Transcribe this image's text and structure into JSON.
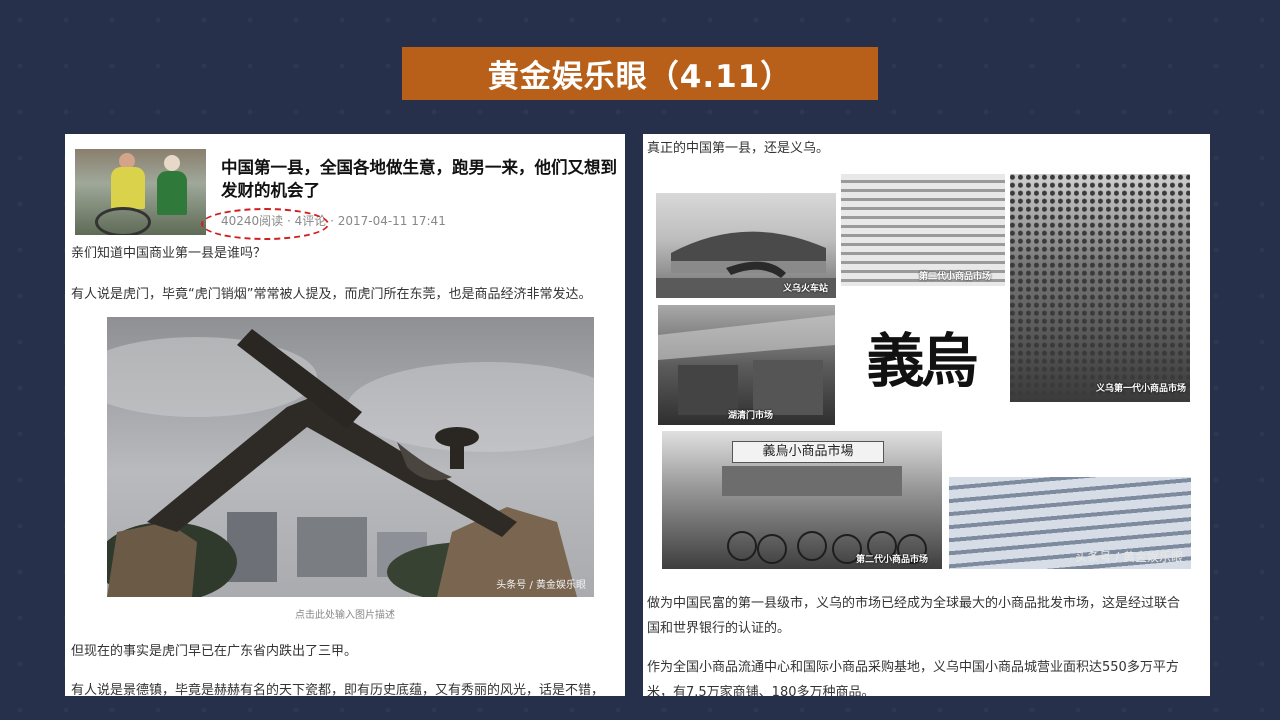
{
  "banner": {
    "title": "黄金娱乐眼（4.11）"
  },
  "left_article": {
    "title_line1": "中国第一县，全国各地做生意，跑男一来，他们又想到",
    "title_line2": "发财的机会了",
    "meta": "40240阅读 · 4评论 · 2017-04-11 17:41",
    "p1": "亲们知道中国商业第一县是谁吗？",
    "p2": "有人说是虎门，毕竟“虎门销烟”常常被人提及，而虎门所在东莞，也是商品经济非常发达。",
    "image_watermark": "头条号 / 黄金娱乐眼",
    "image_caption": "点击此处输入图片描述",
    "p3": "但现在的事实是虎门早已在广东省内跌出了三甲。",
    "p4": "有人说是景德镇，毕竟是赫赫有名的天下瓷都，即有历史底蕴，又有秀丽的风光，话是不错，"
  },
  "right_article": {
    "intro": "真正的中国第一县，还是义乌。",
    "collage": {
      "tile1_caption": "义乌火车站",
      "tile2_caption": "第二代小商品市场",
      "tile3_caption": "义乌第一代小商品市场",
      "tile4_caption": "湖清门市场",
      "calligraphy": "義烏",
      "tile6_caption": "第二代小商品市场",
      "tile6_sign": "義烏小商品市場",
      "watermark": "头条号 / 黄金娱乐眼"
    },
    "p1_line1": "做为中国民富的第一县级市，义乌的市场已经成为全球最大的小商品批发市场，这是经过联合",
    "p1_line2": "国和世界银行的认证的。",
    "p2_line1": "作为全国小商品流通中心和国际小商品采购基地，义乌中国小商品城营业面积达550多万平方",
    "p2_line2": "米，有7.5万家商铺、180多万种商品。"
  }
}
